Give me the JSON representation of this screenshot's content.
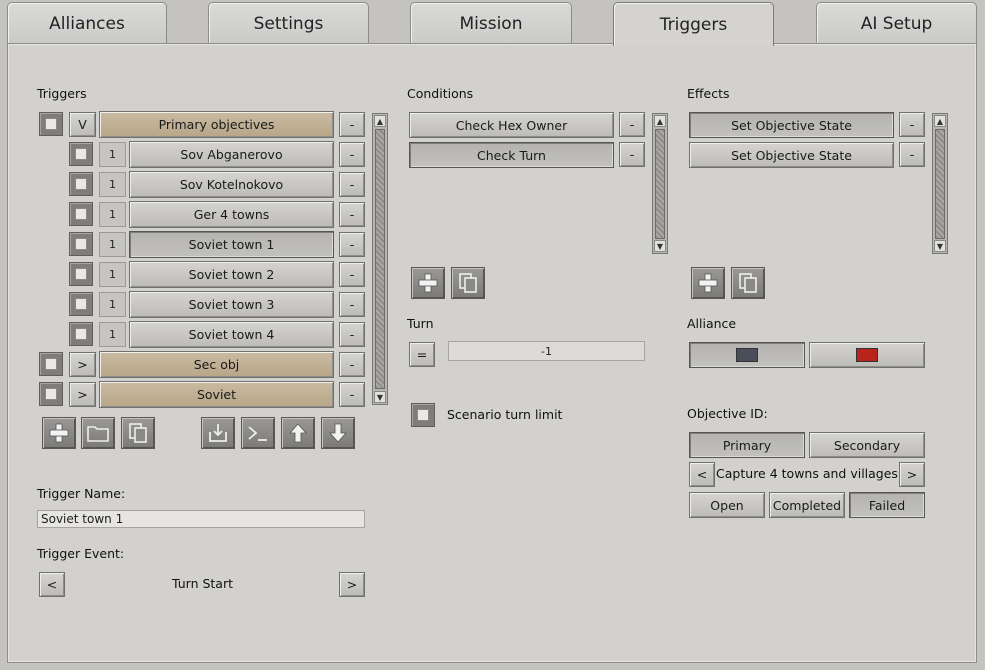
{
  "tabs": [
    "Alliances",
    "Settings",
    "Mission",
    "Triggers",
    "AI Setup"
  ],
  "triggers": {
    "title": "Triggers",
    "groups": [
      {
        "toggle": "V",
        "label": "Primary objectives",
        "remove": "-"
      },
      {
        "toggle": ">",
        "label": "Sec obj",
        "remove": "-"
      },
      {
        "toggle": ">",
        "label": "Soviet",
        "remove": "-"
      }
    ],
    "items": [
      {
        "count": "1",
        "label": "Sov Abganerovo",
        "remove": "-"
      },
      {
        "count": "1",
        "label": "Sov Kotelnokovo",
        "remove": "-"
      },
      {
        "count": "1",
        "label": "Ger 4 towns",
        "remove": "-"
      },
      {
        "count": "1",
        "label": "Soviet town 1",
        "remove": "-"
      },
      {
        "count": "1",
        "label": "Soviet town 2",
        "remove": "-"
      },
      {
        "count": "1",
        "label": "Soviet town 3",
        "remove": "-"
      },
      {
        "count": "1",
        "label": "Soviet town 4",
        "remove": "-"
      }
    ],
    "name_label": "Trigger Name:",
    "name_value": "Soviet town 1",
    "event_label": "Trigger Event:",
    "event_prev": "<",
    "event_value": "Turn Start",
    "event_next": ">"
  },
  "conditions": {
    "title": "Conditions",
    "items": [
      {
        "label": "Check Hex Owner",
        "remove": "-"
      },
      {
        "label": "Check Turn",
        "remove": "-"
      }
    ],
    "turn_label": "Turn",
    "turn_op": "=",
    "turn_value": "-1",
    "limit_label": "Scenario turn limit"
  },
  "effects": {
    "title": "Effects",
    "items": [
      {
        "label": "Set Objective State",
        "remove": "-"
      },
      {
        "label": "Set Objective State",
        "remove": "-"
      }
    ],
    "alliance_label": "Alliance",
    "alliance_colors": [
      "#4a4e58",
      "#b8241c"
    ],
    "objective_label": "Objective ID:",
    "primary": "Primary",
    "secondary": "Secondary",
    "obj_prev": "<",
    "obj_name": "Capture 4 towns and villages",
    "obj_next": ">",
    "open": "Open",
    "completed": "Completed",
    "failed": "Failed"
  },
  "icons": [
    "plus-icon",
    "folder-icon",
    "copy-icon",
    "import-icon",
    "console-icon",
    "arrow-up-icon",
    "arrow-down-icon"
  ]
}
